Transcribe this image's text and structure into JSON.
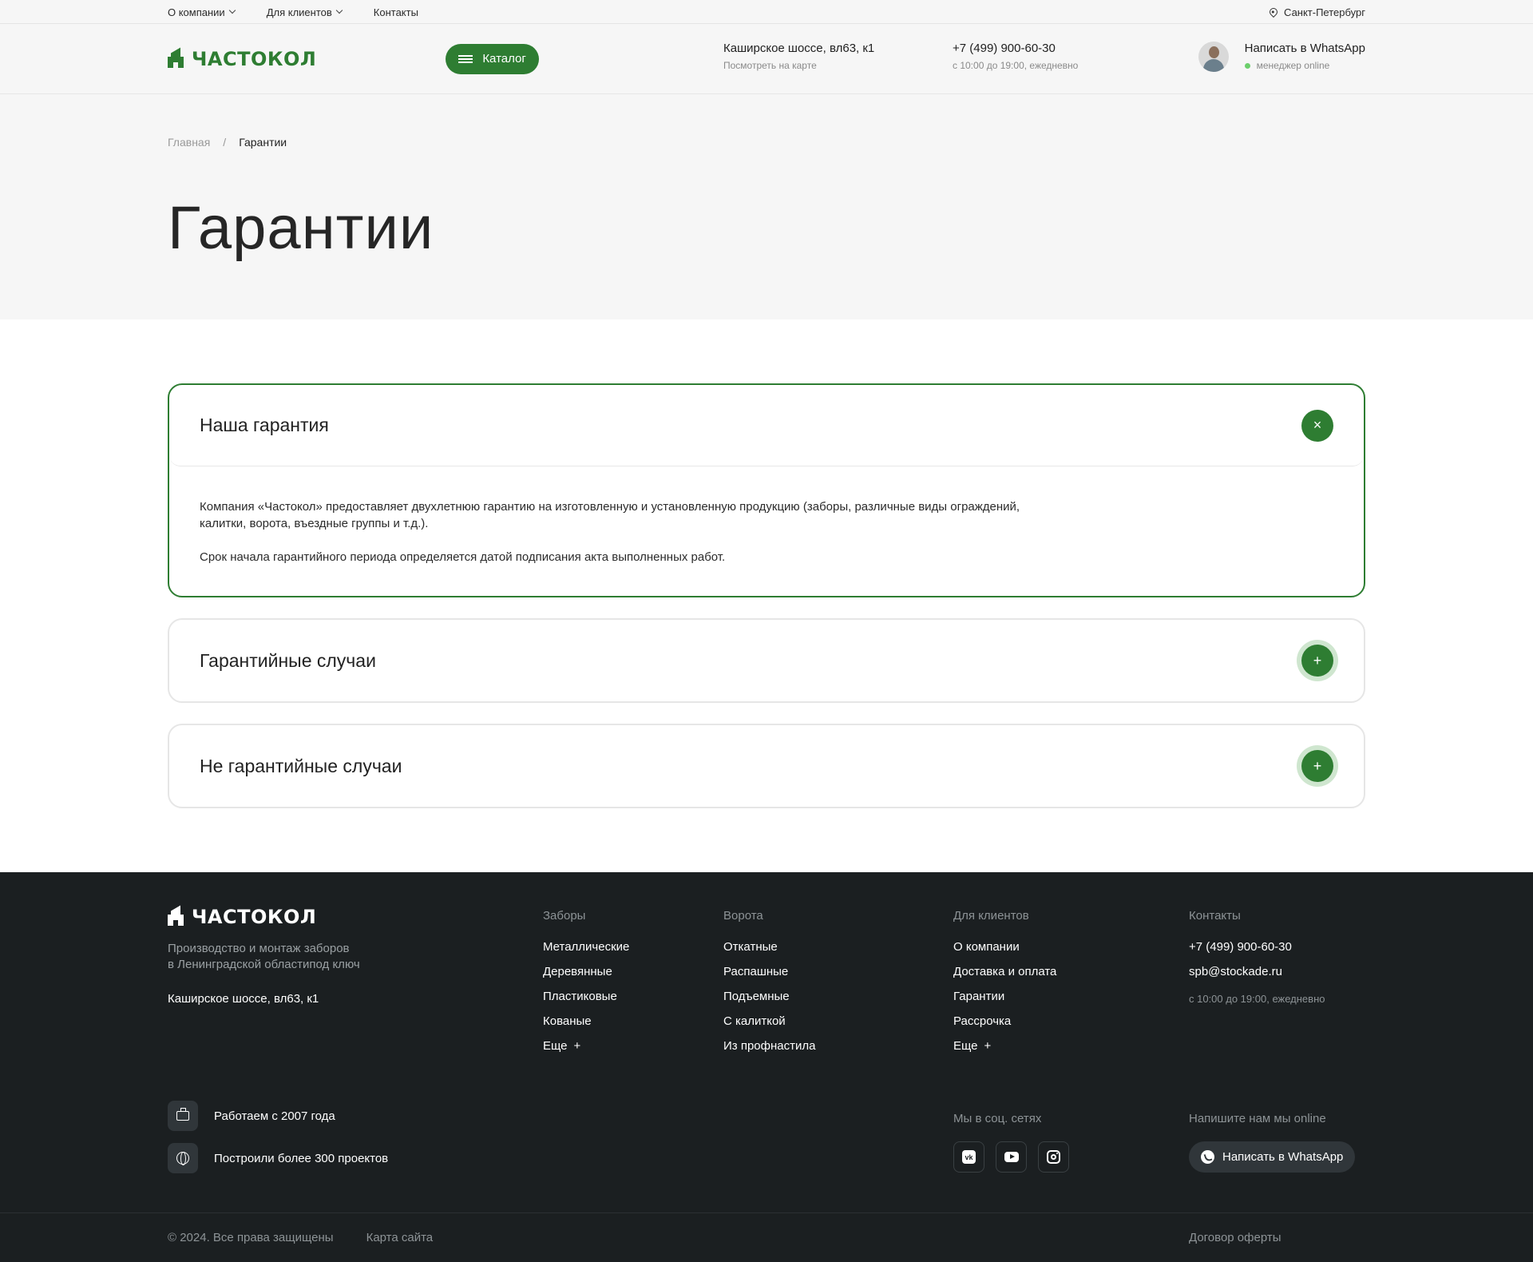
{
  "topbar": {
    "items": [
      {
        "label": "О компании"
      },
      {
        "label": "Для клиентов"
      },
      {
        "label": "Контакты"
      }
    ],
    "city": "Санкт-Петербург"
  },
  "header": {
    "logo": "ЧАСТОКОЛ",
    "catalog_label": "Каталог",
    "address": "Каширское шоссе, вл63, к1",
    "address_sub": "Посмотреть на карте",
    "phone": "+7 (499) 900-60-30",
    "hours": "с 10:00 до 19:00, ежедневно",
    "whatsapp": "Написать в WhatsApp",
    "manager_status": "менеджер online"
  },
  "breadcrumb": {
    "home": "Главная",
    "separator": "/",
    "current": "Гарантии"
  },
  "page_title": "Гарантии",
  "accordion": [
    {
      "title": "Наша гарантия",
      "open": true,
      "button": "×",
      "paragraphs": [
        "Компания «Частокол» предоставляет двухлетнюю гарантию на изготовленную и установленную продукцию (заборы, различные виды ограждений, калитки, ворота, въездные группы и т.д.).",
        "Срок начала гарантийного периода определяется датой подписания акта выполненных работ."
      ]
    },
    {
      "title": "Гарантийные случаи",
      "open": false,
      "button": "+"
    },
    {
      "title": "Не гарантийные случаи",
      "open": false,
      "button": "+"
    }
  ],
  "footer": {
    "logo": "ЧАСТОКОЛ",
    "description_line1": "Производство и монтаж заборов",
    "description_line2": "в Ленинградской областипод ключ",
    "address": "Каширское шоссе, вл63, к1",
    "columns": [
      {
        "heading": "Заборы",
        "links": [
          "Металлические",
          "Деревянные",
          "Пластиковые",
          "Кованые",
          "Еще"
        ]
      },
      {
        "heading": "Ворота",
        "links": [
          "Откатные",
          "Распашные",
          "Подъемные",
          "С калиткой",
          "Из профнастила"
        ]
      },
      {
        "heading": "Для клиентов",
        "links": [
          "О компании",
          "Доставка и оплата",
          "Гарантии",
          "Рассрочка",
          "Еще"
        ]
      },
      {
        "heading": "Контакты",
        "links": [
          "+7 (499) 900-60-30",
          "spb@stockade.ru"
        ],
        "note": "с 10:00 до 19:00, ежедневно"
      }
    ],
    "more_icon": "+",
    "features": [
      "Работаем с 2007 года",
      "Построили более 300 проектов"
    ],
    "social_heading": "Мы в соц. сетях",
    "socials": [
      "vk-icon",
      "youtube-icon",
      "instagram-icon"
    ],
    "write_heading": "Напишите нам мы online",
    "whatsapp_button": "Написать в WhatsApp",
    "copyright": "© 2024. Все права защищены",
    "sitemap": "Карта сайта",
    "offer": "Договор оферты"
  },
  "colors": {
    "brand_green": "#2e7d32",
    "footer_bg": "#1b1f21",
    "hero_bg": "#f6f6f6"
  }
}
